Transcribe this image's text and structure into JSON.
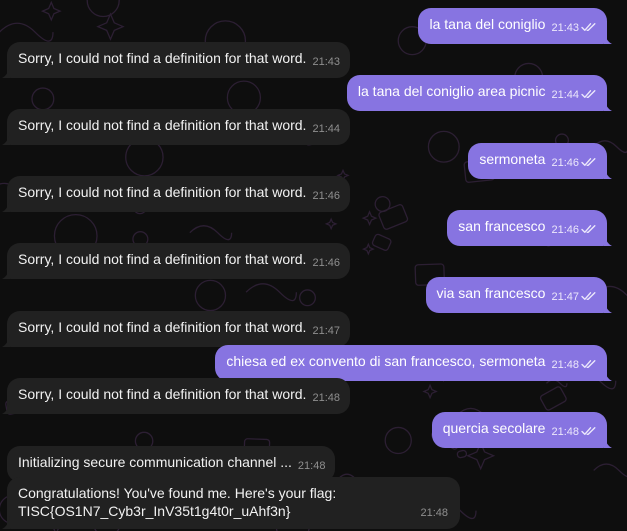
{
  "messages": [
    {
      "side": "out",
      "text": "la tana del coniglio",
      "time": "21:43",
      "read": true
    },
    {
      "side": "in",
      "text": "Sorry, I could not find a definition for that word.",
      "time": "21:43"
    },
    {
      "side": "out",
      "text": "la tana del coniglio area picnic",
      "time": "21:44",
      "read": true
    },
    {
      "side": "in",
      "text": "Sorry, I could not find a definition for that word.",
      "time": "21:44"
    },
    {
      "side": "out",
      "text": "sermoneta",
      "time": "21:46",
      "read": true
    },
    {
      "side": "in",
      "text": "Sorry, I could not find a definition for that word.",
      "time": "21:46"
    },
    {
      "side": "out",
      "text": "san francesco",
      "time": "21:46",
      "read": true
    },
    {
      "side": "in",
      "text": "Sorry, I could not find a definition for that word.",
      "time": "21:46"
    },
    {
      "side": "out",
      "text": "via san francesco",
      "time": "21:47",
      "read": true
    },
    {
      "side": "in",
      "text": "Sorry, I could not find a definition for that word.",
      "time": "21:47"
    },
    {
      "side": "out",
      "text": "chiesa ed ex convento di san francesco, sermoneta",
      "time": "21:48",
      "read": true
    },
    {
      "side": "in",
      "text": "Sorry, I could not find a definition for that word.",
      "time": "21:48"
    },
    {
      "side": "out",
      "text": "quercia secolare",
      "time": "21:48",
      "read": true
    },
    {
      "side": "in",
      "text": "Initializing secure communication channel ...",
      "time": "21:48"
    },
    {
      "side": "in",
      "lines": [
        "Congratulations! You've found me. Here's your flag:",
        "TISC{OS1N7_Cyb3r_InV35t1g4t0r_uAhf3n}"
      ],
      "time": "21:48"
    }
  ],
  "colors": {
    "background": "#0e0e0e",
    "incoming_bubble": "#212121",
    "outgoing_bubble": "#8774e1",
    "doodle": "#2c1f33"
  },
  "icons": {
    "read_receipt": "double-check-icon",
    "background": "doodle-pattern"
  }
}
